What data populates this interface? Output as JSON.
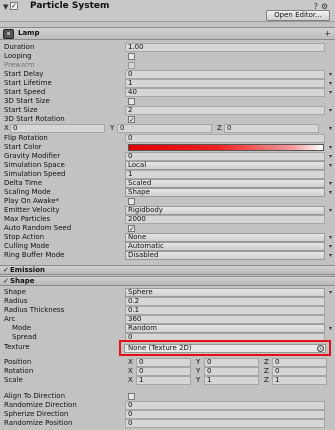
{
  "window": {
    "title": "Particle System",
    "open_editor": "Open Editor...",
    "component_name": "Lamp",
    "enabled_mark": "✓"
  },
  "main": {
    "duration": {
      "label": "Duration",
      "value": "1.00"
    },
    "looping": {
      "label": "Looping"
    },
    "prewarm": {
      "label": "Prewarm"
    },
    "start_delay": {
      "label": "Start Delay",
      "value": "0"
    },
    "start_lifetime": {
      "label": "Start Lifetime",
      "value": "1"
    },
    "start_speed": {
      "label": "Start Speed",
      "value": "40"
    },
    "start_size_3d": {
      "label": "3D Start Size"
    },
    "start_size": {
      "label": "Start Size",
      "value": "2"
    },
    "start_rotation_3d": {
      "label": "3D Start Rotation",
      "check": "✓"
    },
    "rotation_xyz": {
      "x_label": "X",
      "x": "0",
      "y_label": "Y",
      "y": "0",
      "z_label": "Z",
      "z": "0"
    },
    "flip_rotation": {
      "label": "Flip Rotation",
      "value": "0"
    },
    "start_color": {
      "label": "Start Color"
    },
    "gravity_modifier": {
      "label": "Gravity Modifier",
      "value": "0"
    },
    "simulation_space": {
      "label": "Simulation Space",
      "value": "Local"
    },
    "simulation_speed": {
      "label": "Simulation Speed",
      "value": "1"
    },
    "delta_time": {
      "label": "Delta Time",
      "value": "Scaled"
    },
    "scaling_mode": {
      "label": "Scaling Mode",
      "value": "Shape"
    },
    "play_on_awake": {
      "label": "Play On Awake*"
    },
    "emitter_velocity": {
      "label": "Emitter Velocity",
      "value": "Rigidbody"
    },
    "max_particles": {
      "label": "Max Particles",
      "value": "2000"
    },
    "auto_random_seed": {
      "label": "Auto Random Seed",
      "check": "✓"
    },
    "stop_action": {
      "label": "Stop Action",
      "value": "None"
    },
    "culling_mode": {
      "label": "Culling Mode",
      "value": "Automatic"
    },
    "ring_buffer_mode": {
      "label": "Ring Buffer Mode",
      "value": "Disabled"
    }
  },
  "sections": {
    "emission": {
      "label": "Emission",
      "mark": "✓"
    },
    "shape": {
      "label": "Shape",
      "mark": "✓"
    }
  },
  "shape": {
    "shape": {
      "label": "Shape",
      "value": "Sphere"
    },
    "radius": {
      "label": "Radius",
      "value": "0.2"
    },
    "radius_thickness": {
      "label": "Radius Thickness",
      "value": "0.1"
    },
    "arc": {
      "label": "Arc",
      "value": "360"
    },
    "mode": {
      "label": "Mode",
      "value": "Random"
    },
    "spread": {
      "label": "Spread",
      "value": "0"
    },
    "texture": {
      "label": "Texture",
      "value": "None (Texture 2D)"
    },
    "position": {
      "label": "Position",
      "x_label": "X",
      "x": "0",
      "y_label": "Y",
      "y": "0",
      "z_label": "Z",
      "z": "0"
    },
    "rotation": {
      "label": "Rotation",
      "x_label": "X",
      "x": "0",
      "y_label": "Y",
      "y": "0",
      "z_label": "Z",
      "z": "0"
    },
    "scale": {
      "label": "Scale",
      "x_label": "X",
      "x": "1",
      "y_label": "Y",
      "y": "1",
      "z_label": "Z",
      "z": "1"
    },
    "align_to_direction": {
      "label": "Align To Direction"
    },
    "randomize_direction": {
      "label": "Randomize Direction",
      "value": "0"
    },
    "spherize_direction": {
      "label": "Spherize Direction",
      "value": "0"
    },
    "randomize_position": {
      "label": "Randomize Position",
      "value": "0"
    }
  },
  "colors": {
    "highlight": "#e0101a",
    "panel": "#c2c2c2"
  }
}
